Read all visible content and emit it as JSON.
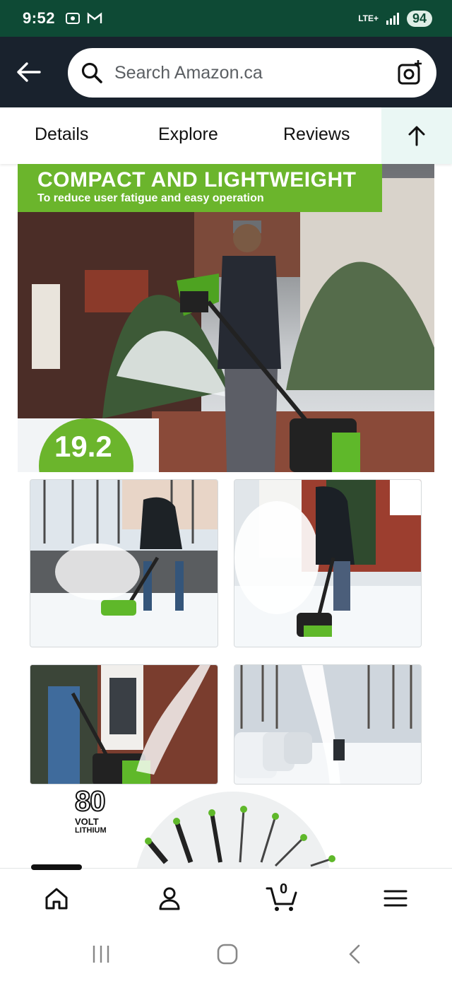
{
  "status_bar": {
    "time": "9:52",
    "network": "LTE+",
    "battery": "94"
  },
  "header": {
    "search_placeholder": "Search Amazon.ca"
  },
  "tabs": [
    {
      "label": "Details"
    },
    {
      "label": "Explore"
    },
    {
      "label": "Reviews"
    }
  ],
  "hero": {
    "headline": "COMPACT AND LIGHTWEIGHT",
    "subline": "To reduce user fatigue and easy operation",
    "badge": "19.2"
  },
  "promo": {
    "volt_number": "80",
    "volt_label": "VOLT",
    "volt_sub": "LITHIUM"
  },
  "bottom_nav": {
    "cart_count": "0"
  },
  "colors": {
    "status_bar": "#0e4a35",
    "header": "#19222d",
    "brand_green": "#6bb52c"
  }
}
